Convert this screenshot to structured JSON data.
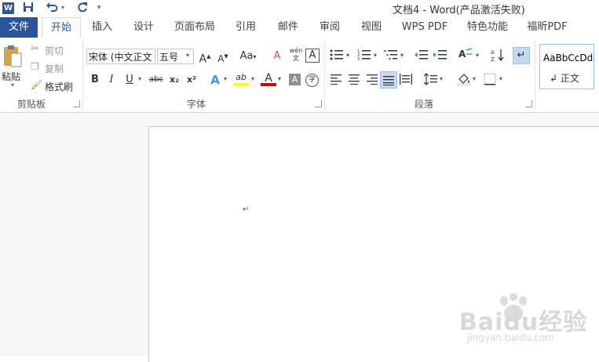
{
  "window": {
    "title": "文档4 - Word(产品激活失败)"
  },
  "quick_access": {
    "icons": [
      "word-logo-icon",
      "save-icon",
      "undo-icon",
      "redo-icon",
      "customize-icon"
    ],
    "word_logo_text": "W"
  },
  "tabs": [
    {
      "label": "文件"
    },
    {
      "label": "开始"
    },
    {
      "label": "插入"
    },
    {
      "label": "设计"
    },
    {
      "label": "页面布局"
    },
    {
      "label": "引用"
    },
    {
      "label": "邮件"
    },
    {
      "label": "审阅"
    },
    {
      "label": "视图"
    },
    {
      "label": "WPS PDF"
    },
    {
      "label": "特色功能"
    },
    {
      "label": "福昕PDF"
    }
  ],
  "active_tab": "开始",
  "clipboard": {
    "paste_label": "粘贴",
    "cut_label": "剪切",
    "copy_label": "复制",
    "format_painter_label": "格式刷",
    "group_label": "剪贴板"
  },
  "font": {
    "font_name": "宋体 (中文正文",
    "font_size": "五号",
    "grow": "A",
    "shrink": "A",
    "change_case": "Aa",
    "clear": "A",
    "phonetic": "wén\n文",
    "border": "A",
    "bold": "B",
    "italic": "I",
    "underline": "U",
    "strikethrough": "abc",
    "subscript": "x₂",
    "superscript": "x²",
    "text_effects": "A",
    "highlight": "ab",
    "font_color": "A",
    "shading": "A",
    "enclose": "字",
    "group_label": "字体"
  },
  "paragraph": {
    "group_label": "段落"
  },
  "styles": {
    "sample": "AaBbCcDd",
    "name": "↲ 正文"
  },
  "document": {
    "paragraph_mark": "↵"
  },
  "watermark": {
    "text": "Baidu经验",
    "url": "jingyan.baidu.com"
  },
  "colors": {
    "brand": "#2b579a",
    "highlight_yellow": "#ffff00",
    "font_red": "#e00000",
    "selected_button": "#c5d9f1"
  }
}
